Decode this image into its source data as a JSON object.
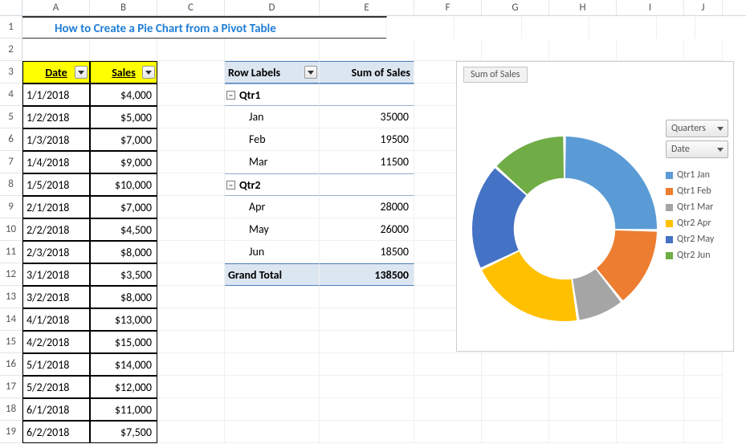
{
  "title": "How to Create a Pie Chart from a Pivot Table",
  "columns": [
    "A",
    "B",
    "C",
    "D",
    "E",
    "F",
    "G",
    "H",
    "I",
    "J"
  ],
  "row_numbers": [
    1,
    2,
    3,
    4,
    5,
    6,
    7,
    8,
    9,
    10,
    11,
    12,
    13,
    14,
    15,
    16,
    17,
    18,
    19
  ],
  "data_table": {
    "headers": {
      "A": "Date",
      "B": "Sales"
    },
    "rows": [
      {
        "date": "1/1/2018",
        "sales": "$4,000"
      },
      {
        "date": "1/2/2018",
        "sales": "$5,000"
      },
      {
        "date": "1/3/2018",
        "sales": "$7,000"
      },
      {
        "date": "1/4/2018",
        "sales": "$9,000"
      },
      {
        "date": "1/5/2018",
        "sales": "$10,000"
      },
      {
        "date": "2/1/2018",
        "sales": "$7,000"
      },
      {
        "date": "2/2/2018",
        "sales": "$4,500"
      },
      {
        "date": "2/3/2018",
        "sales": "$8,000"
      },
      {
        "date": "3/1/2018",
        "sales": "$3,500"
      },
      {
        "date": "3/2/2018",
        "sales": "$8,000"
      },
      {
        "date": "4/1/2018",
        "sales": "$13,000"
      },
      {
        "date": "4/2/2018",
        "sales": "$15,000"
      },
      {
        "date": "5/1/2018",
        "sales": "$14,000"
      },
      {
        "date": "5/2/2018",
        "sales": "$12,000"
      },
      {
        "date": "6/1/2018",
        "sales": "$11,000"
      },
      {
        "date": "6/2/2018",
        "sales": "$7,500"
      }
    ]
  },
  "pivot": {
    "row_labels_header": "Row Labels",
    "value_header": "Sum of Sales",
    "q1_label": "Qtr1",
    "q2_label": "Qtr2",
    "months": {
      "jan": {
        "label": "Jan",
        "value": "35000"
      },
      "feb": {
        "label": "Feb",
        "value": "19500"
      },
      "mar": {
        "label": "Mar",
        "value": "11500"
      },
      "apr": {
        "label": "Apr",
        "value": "28000"
      },
      "may": {
        "label": "May",
        "value": "26000"
      },
      "jun": {
        "label": "Jun",
        "value": "18500"
      }
    },
    "grand_label": "Grand Total",
    "grand_value": "138500"
  },
  "chart": {
    "title_chip": "Sum of Sales",
    "field_btns": {
      "quarters": "Quarters",
      "date": "Date"
    },
    "legend": [
      {
        "label": "Qtr1 Jan",
        "color": "#5B9BD5"
      },
      {
        "label": "Qtr1 Feb",
        "color": "#ED7D31"
      },
      {
        "label": "Qtr1 Mar",
        "color": "#A5A5A5"
      },
      {
        "label": "Qtr2 Apr",
        "color": "#FFC000"
      },
      {
        "label": "Qtr2 May",
        "color": "#4472C4"
      },
      {
        "label": "Qtr2 Jun",
        "color": "#70AD47"
      }
    ]
  },
  "chart_data": {
    "type": "pie",
    "title": "Sum of Sales",
    "categories": [
      "Qtr1 Jan",
      "Qtr1 Feb",
      "Qtr1 Mar",
      "Qtr2 Apr",
      "Qtr2 May",
      "Qtr2 Jun"
    ],
    "values": [
      35000,
      19500,
      11500,
      28000,
      26000,
      18500
    ],
    "colors": [
      "#5B9BD5",
      "#ED7D31",
      "#A5A5A5",
      "#FFC000",
      "#4472C4",
      "#70AD47"
    ],
    "grand_total": 138500,
    "inner_radius_frac": 0.55
  }
}
